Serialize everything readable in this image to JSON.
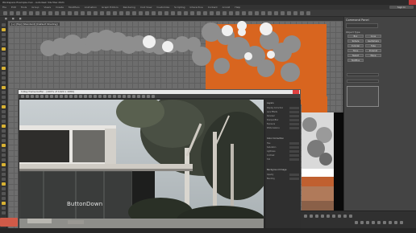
{
  "app": {
    "title": "Workspace Example.max - Autodesk 3ds Max 2021",
    "signin_label": "Sign In",
    "menu": [
      "File",
      "Edit",
      "Tools",
      "Group",
      "Views",
      "Create",
      "Modifiers",
      "Animation",
      "Graph Editors",
      "Rendering",
      "Civil View",
      "Customize",
      "Scripting",
      "Interactive",
      "Content",
      "Arnold",
      "Help"
    ]
  },
  "viewport": {
    "label": "[+] [Top] [Standard] [Default Shading]"
  },
  "render_window": {
    "title": "V-Ray frame buffer - [100% of 1920 x 1080]",
    "overlay_text": "ButtonDown",
    "panel_sections": [
      {
        "title": "Layers",
        "rows": [
          "Display Correction",
          "Lens Effects",
          "Denoiser",
          "Sharpen/Blur",
          "Exposure",
          "White balance"
        ]
      },
      {
        "title": "Color Correction",
        "rows": [
          "Hue",
          "Saturation",
          "Lightness",
          "Contrast",
          "Tint"
        ]
      },
      {
        "title": "Background Image",
        "rows": [
          "Opacity",
          "Blending"
        ]
      }
    ]
  },
  "right_panel": {
    "title": "Command Panel",
    "section_label": "Object Type",
    "buttons": [
      "Box",
      "Cone",
      "Sphere",
      "GeoSphere",
      "Cylinder",
      "Tube",
      "Torus",
      "Pyramid",
      "Teapot",
      "Plane",
      "TextPlus"
    ]
  },
  "colors": {
    "accent_orange": "#d8651f",
    "close_red": "#e04040",
    "badge_red": "#d05a48"
  }
}
